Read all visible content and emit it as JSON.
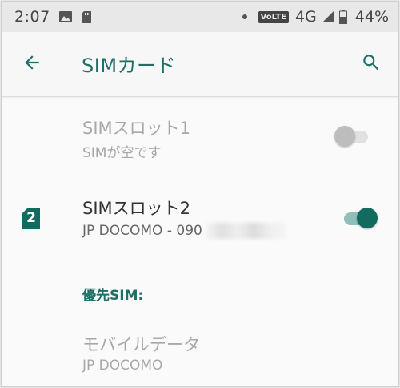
{
  "status_bar": {
    "time": "2:07",
    "left_icons": [
      "image-icon",
      "sd-card-icon"
    ],
    "network_badge": "VoLTE",
    "network_type": "4G",
    "battery_percent": "44%"
  },
  "toolbar": {
    "title": "SIMカード",
    "back_icon": "arrow-back-icon",
    "search_icon": "search-icon"
  },
  "sim_slots": [
    {
      "title": "SIMスロット1",
      "subtitle": "SIMが空です",
      "enabled": false
    },
    {
      "title": "SIMスロット2",
      "subtitle": "JP DOCOMO - 090",
      "badge_number": "2",
      "enabled": true
    }
  ],
  "preferred_sim": {
    "header": "優先SIM:",
    "mobile_data_title": "モバイルデータ",
    "mobile_data_value": "JP DOCOMO"
  },
  "colors": {
    "accent": "#1f6f66",
    "toggle_on": "#136b60",
    "toggle_track_on": "#8fbfb8",
    "disabled_text": "#a8a8a8"
  }
}
